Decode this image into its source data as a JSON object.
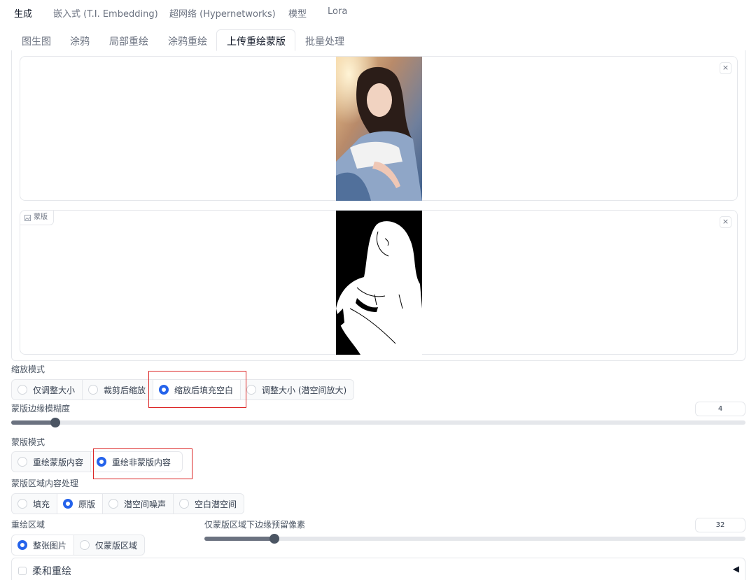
{
  "top_tabs": [
    {
      "label": "生成",
      "active": true
    },
    {
      "label": "嵌入式 (T.I. Embedding)",
      "active": false
    },
    {
      "label": "超网络 (Hypernetworks)",
      "active": false
    },
    {
      "label": "模型",
      "active": false
    },
    {
      "label": "Lora",
      "active": false
    }
  ],
  "sub_tabs": [
    {
      "label": "图生图"
    },
    {
      "label": "涂鸦"
    },
    {
      "label": "局部重绘"
    },
    {
      "label": "涂鸦重绘"
    },
    {
      "label": "上传重绘蒙版",
      "active": true
    },
    {
      "label": "批量处理"
    }
  ],
  "image_panel": {
    "close_label": "×"
  },
  "mask_panel": {
    "label": "蒙版",
    "close_label": "×"
  },
  "resize_mode": {
    "label": "缩放模式",
    "options": [
      "仅调整大小",
      "裁剪后缩放",
      "缩放后填充空白",
      "调整大小 (潜空间放大)"
    ],
    "selected": "缩放后填充空白"
  },
  "mask_blur": {
    "label": "蒙版边缘模糊度",
    "value": "4",
    "fraction": 0.06
  },
  "mask_mode": {
    "label": "蒙版模式",
    "options": [
      "重绘蒙版内容",
      "重绘非蒙版内容"
    ],
    "selected": "重绘非蒙版内容"
  },
  "masked_content": {
    "label": "蒙版区域内容处理",
    "options": [
      "填充",
      "原版",
      "潜空间噪声",
      "空白潜空间"
    ],
    "selected": "原版"
  },
  "inpaint_area": {
    "label": "重绘区域",
    "options": [
      "整张图片",
      "仅蒙版区域"
    ],
    "selected": "整张图片"
  },
  "padding": {
    "label": "仅蒙版区域下边缘预留像素",
    "value": "32",
    "fraction": 0.13
  },
  "soft_inpaint": {
    "label": "柔和重绘",
    "arrow": "◀"
  },
  "colors": {
    "accent": "#2563eb",
    "highlight": "#dc2626"
  }
}
